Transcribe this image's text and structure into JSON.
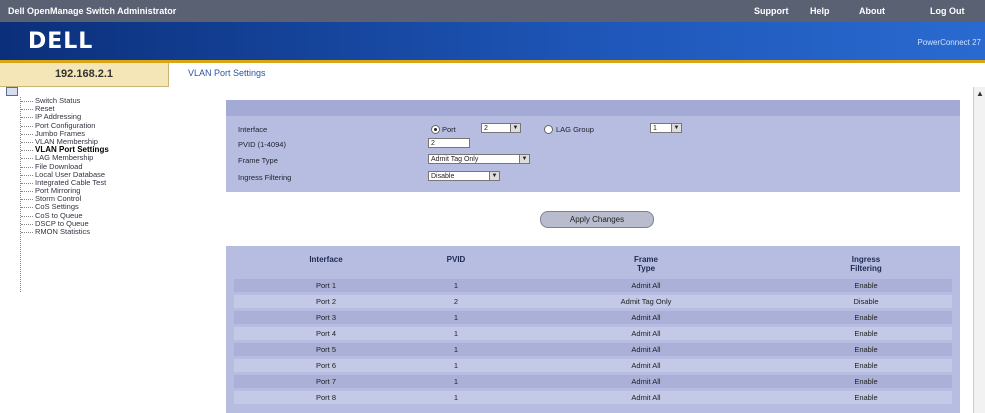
{
  "header": {
    "app_title": "Dell OpenManage Switch Administrator",
    "nav": [
      "Support",
      "Help",
      "About",
      "Log Out"
    ],
    "logo": "DELL",
    "device_name": "PowerConnect 27"
  },
  "ip_address": "192.168.2.1",
  "page_title": "VLAN Port Settings",
  "sidebar": {
    "items": [
      "Switch Status",
      "Reset",
      "IP Addressing",
      "Port Configuration",
      "Jumbo Frames",
      "VLAN Membership",
      "VLAN Port Settings",
      "LAG Membership",
      "File Download",
      "Local User Database",
      "Integrated Cable Test",
      "Port Mirroring",
      "Storm Control",
      "CoS Settings",
      "CoS to Queue",
      "DSCP to Queue",
      "RMON Statistics"
    ],
    "active_index": 6
  },
  "form": {
    "interface_label": "Interface",
    "port_label": "Port",
    "port_value": "2",
    "lag_label": "LAG Group",
    "lag_value": "1",
    "pvid_label": "PVID (1-4094)",
    "pvid_value": "2",
    "frame_type_label": "Frame Type",
    "frame_type_value": "Admit Tag Only",
    "ingress_label": "Ingress Filtering",
    "ingress_value": "Disable",
    "apply_label": "Apply Changes"
  },
  "table": {
    "headers": [
      "Interface",
      "PVID",
      "Frame\nType",
      "Ingress\nFiltering"
    ],
    "rows": [
      [
        "Port 1",
        "1",
        "Admit All",
        "Enable"
      ],
      [
        "Port 2",
        "2",
        "Admit Tag Only",
        "Disable"
      ],
      [
        "Port 3",
        "1",
        "Admit All",
        "Enable"
      ],
      [
        "Port 4",
        "1",
        "Admit All",
        "Enable"
      ],
      [
        "Port 5",
        "1",
        "Admit All",
        "Enable"
      ],
      [
        "Port 6",
        "1",
        "Admit All",
        "Enable"
      ],
      [
        "Port 7",
        "1",
        "Admit All",
        "Enable"
      ],
      [
        "Port 8",
        "1",
        "Admit All",
        "Enable"
      ]
    ]
  }
}
